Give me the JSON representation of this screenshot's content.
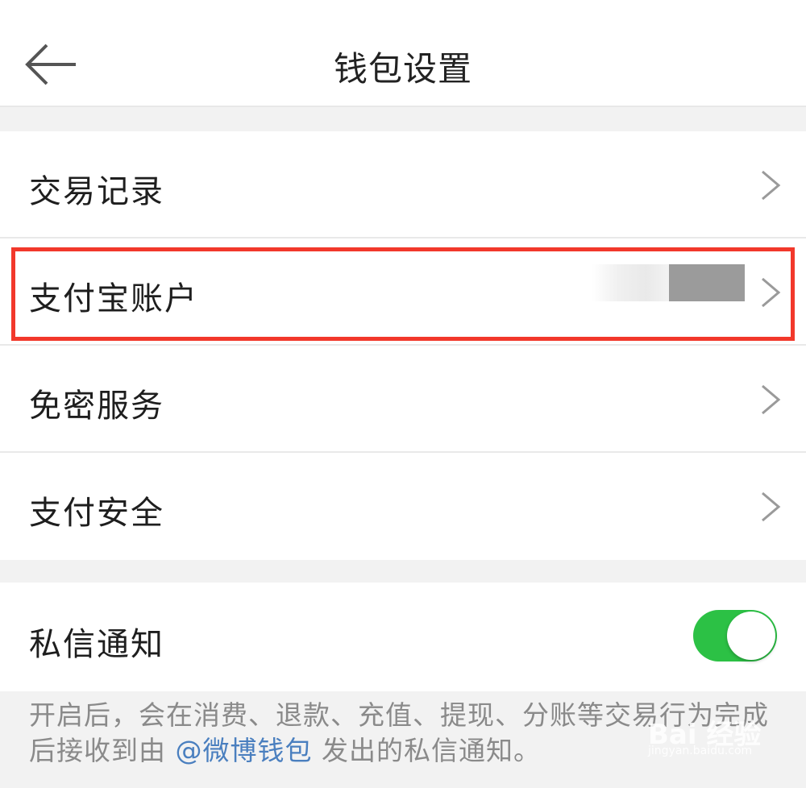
{
  "header": {
    "title": "钱包设置",
    "back_icon": "arrow-left-icon"
  },
  "menu": {
    "items": [
      {
        "label": "交易记录",
        "icon": "chevron-right-icon"
      },
      {
        "label": "支付宝账户",
        "icon": "chevron-right-icon"
      },
      {
        "label": "免密服务",
        "icon": "chevron-right-icon"
      },
      {
        "label": "支付安全",
        "icon": "chevron-right-icon"
      }
    ]
  },
  "notification": {
    "label": "私信通知",
    "toggle_on": true,
    "hint_before": "开启后，会在消费、退款、充值、提现、分账等交易行为完成后接收到由 ",
    "hint_link": "@微博钱包",
    "hint_after": " 发出的私信通知。"
  },
  "colors": {
    "toggle_on": "#2cc145",
    "highlight": "#f2382b",
    "link": "#4a7fbf"
  },
  "watermark": {
    "text": "Bai 经验",
    "sub": "jingyan.baidu.com"
  }
}
